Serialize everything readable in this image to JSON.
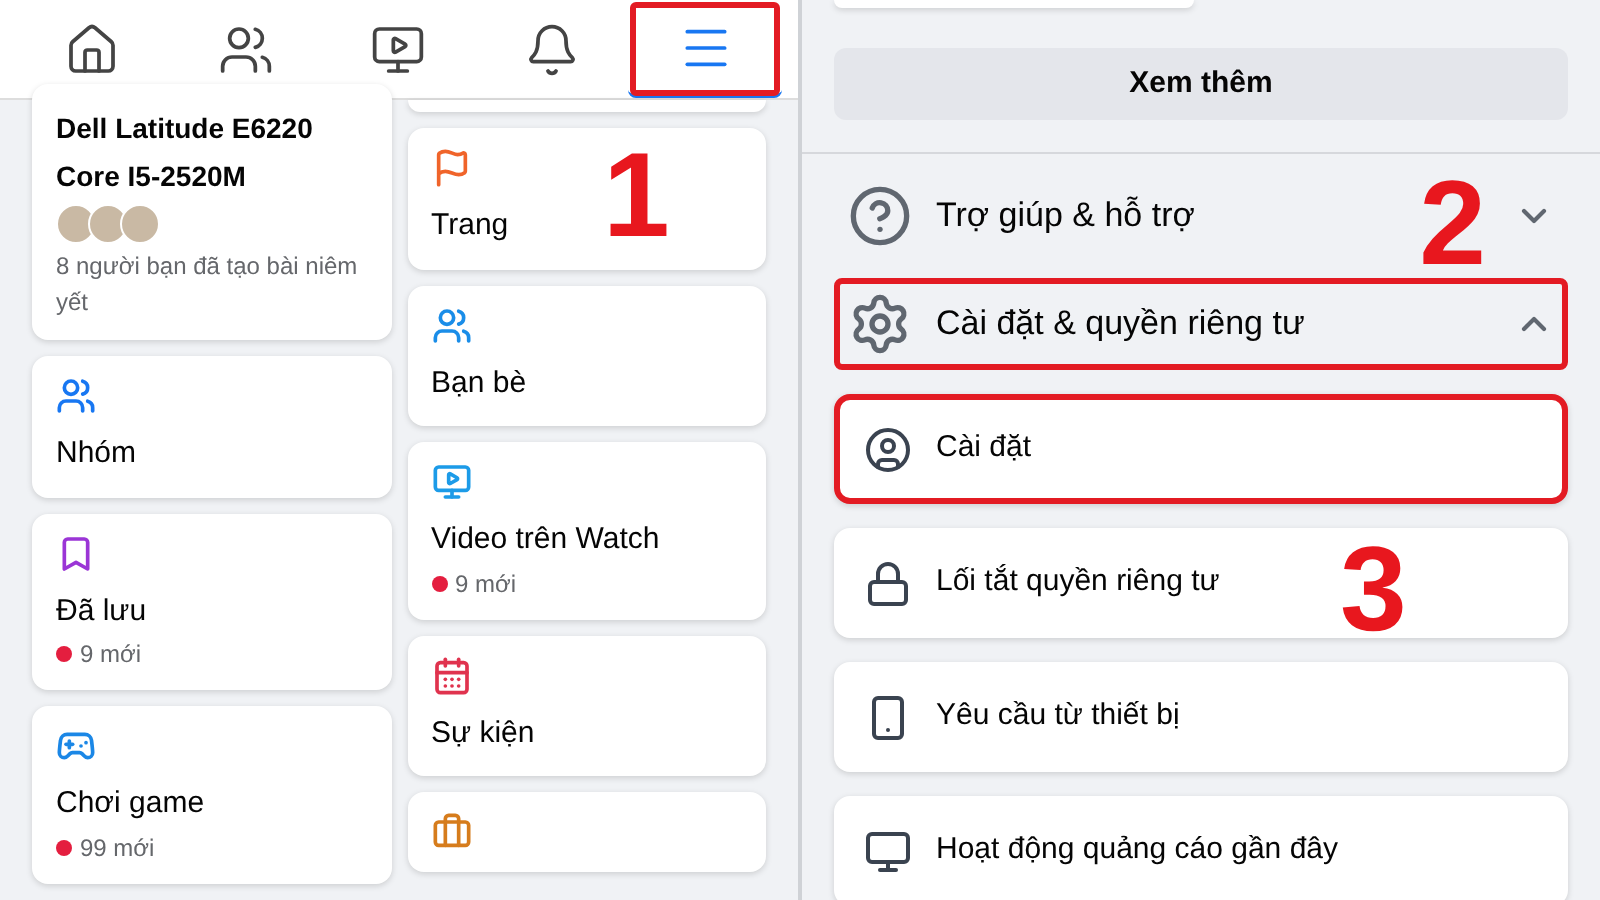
{
  "left_screen": {
    "nav_tabs": [
      {
        "kind": "home",
        "selected": false,
        "highlighted": false
      },
      {
        "kind": "groups",
        "selected": false,
        "highlighted": false
      },
      {
        "kind": "watch",
        "selected": false,
        "highlighted": false
      },
      {
        "kind": "bell",
        "selected": false,
        "highlighted": false
      },
      {
        "kind": "menu",
        "selected": true,
        "highlighted": true
      }
    ],
    "column_1": [
      {
        "kind": "listing",
        "title": "Dell Latitude E6220 Core I5-2520M",
        "subtitle": "8 người bạn đã tạo bài niêm yết"
      },
      {
        "kind": "groups",
        "title": "Nhóm"
      },
      {
        "kind": "saved",
        "title": "Đã lưu",
        "badge": "9 mới"
      },
      {
        "kind": "gaming",
        "title": "Chơi game",
        "badge": "99 mới"
      }
    ],
    "column_2": [
      {
        "kind": "pages",
        "title": "Trang"
      },
      {
        "kind": "friends",
        "title": "Bạn bè"
      },
      {
        "kind": "watch",
        "title": "Video trên Watch",
        "badge": "9 mới"
      },
      {
        "kind": "events",
        "title": "Sự kiện"
      },
      {
        "kind": "jobs"
      }
    ]
  },
  "right_screen": {
    "see_more_button": "Xem thêm",
    "sections": [
      {
        "kind": "help",
        "label": "Trợ giúp & hỗ trợ",
        "expanded": false,
        "highlighted": false
      },
      {
        "kind": "settings",
        "label": "Cài đặt & quyền riêng tư",
        "expanded": true,
        "highlighted": true
      }
    ],
    "items": [
      {
        "kind": "account",
        "label": "Cài đặt",
        "highlighted": true
      },
      {
        "kind": "lock",
        "label": "Lối tắt quyền riêng tư",
        "highlighted": false
      },
      {
        "kind": "phone",
        "label": "Yêu cầu từ thiết bị",
        "highlighted": false
      },
      {
        "kind": "monitor",
        "label": "Hoạt động quảng cáo gần đây",
        "highlighted": false
      }
    ]
  },
  "step_numbers": [
    "1",
    "2",
    "3"
  ]
}
